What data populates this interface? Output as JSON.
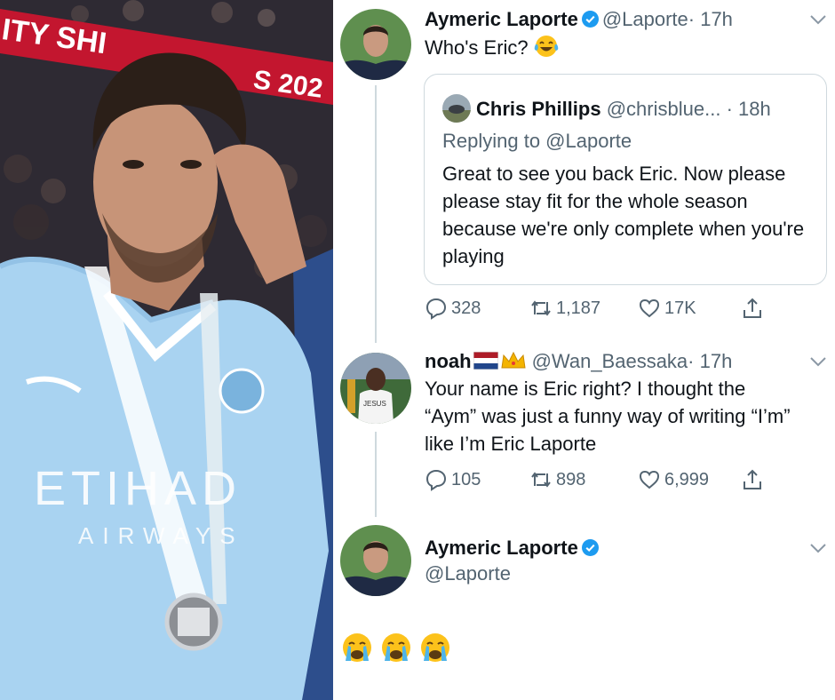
{
  "photo": {
    "banner_text_left": "ITY SHI",
    "banner_text_right": "S 202",
    "shirt_sponsor": "ETIHAD",
    "shirt_sponsor_sub": "AIRWAYS",
    "colors": {
      "shirt": "#a9d3f1",
      "banner": "#c3162f",
      "skin": "#c79478",
      "hair": "#2b1f18"
    }
  },
  "tweets": [
    {
      "name": "Aymeric Laporte",
      "handle": "@Laporte",
      "time": "· 17h",
      "text": "Who's Eric?",
      "emoji": "laughing-tears",
      "quote": {
        "name": "Chris Phillips",
        "handle": "@chrisblue...",
        "time": "· 18h",
        "replying_to": "Replying to @Laporte",
        "text": "Great to see you back Eric. Now please please stay fit for the whole season because we're only complete when you're playing"
      },
      "stats": {
        "replies": "328",
        "retweets": "1,187",
        "likes": "17K"
      }
    },
    {
      "name": "noah",
      "handle": "@Wan_Baessaka",
      "time": "· 17h",
      "text": "Your name is Eric right? I thought the “Aym” was just a funny way of writing “I’m” like I’m Eric Laporte",
      "stats": {
        "replies": "105",
        "retweets": "898",
        "likes": "6,999"
      }
    },
    {
      "name": "Aymeric Laporte",
      "handle": "@Laporte",
      "emojis": [
        "crying-face",
        "crying-face",
        "crying-face"
      ]
    }
  ],
  "colors": {
    "verified": "#1d9bf0",
    "muted": "#536471",
    "border": "#cfd9de"
  }
}
